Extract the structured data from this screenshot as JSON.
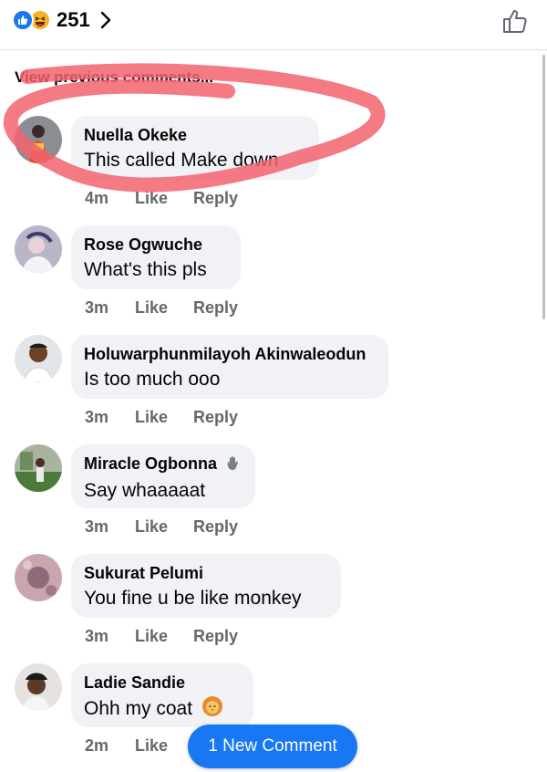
{
  "header": {
    "reaction_count": "251",
    "reaction_icons": [
      "like-icon",
      "haha-icon"
    ]
  },
  "view_previous": "View previous comments...",
  "comments": [
    {
      "name": "Nuella Okeke",
      "text": "This called Make down",
      "time": "4m",
      "like": "Like",
      "reply": "Reply"
    },
    {
      "name": "Rose Ogwuche",
      "text": "What's this pls",
      "time": "3m",
      "like": "Like",
      "reply": "Reply"
    },
    {
      "name": "Holuwarphunmilayoh Akinwaleodun",
      "text": "Is too much ooo",
      "time": "3m",
      "like": "Like",
      "reply": "Reply"
    },
    {
      "name": "Miracle Ogbonna",
      "text": "Say whaaaaat",
      "time": "3m",
      "like": "Like",
      "reply": "Reply",
      "badge": "waving-hand-icon"
    },
    {
      "name": "Sukurat Pelumi",
      "text": "You fine u be like monkey",
      "time": "3m",
      "like": "Like",
      "reply": "Reply"
    },
    {
      "name": "Ladie Sandie",
      "text": "Ohh my coat",
      "time": "2m",
      "like": "Like",
      "emoji": "lion-face-icon"
    }
  ],
  "new_comment_button": "1 New Comment",
  "colors": {
    "brand_blue": "#1877f2",
    "bubble_bg": "#f0f2f5",
    "meta_gray": "#65676b",
    "scribble_red": "#f2636e"
  }
}
